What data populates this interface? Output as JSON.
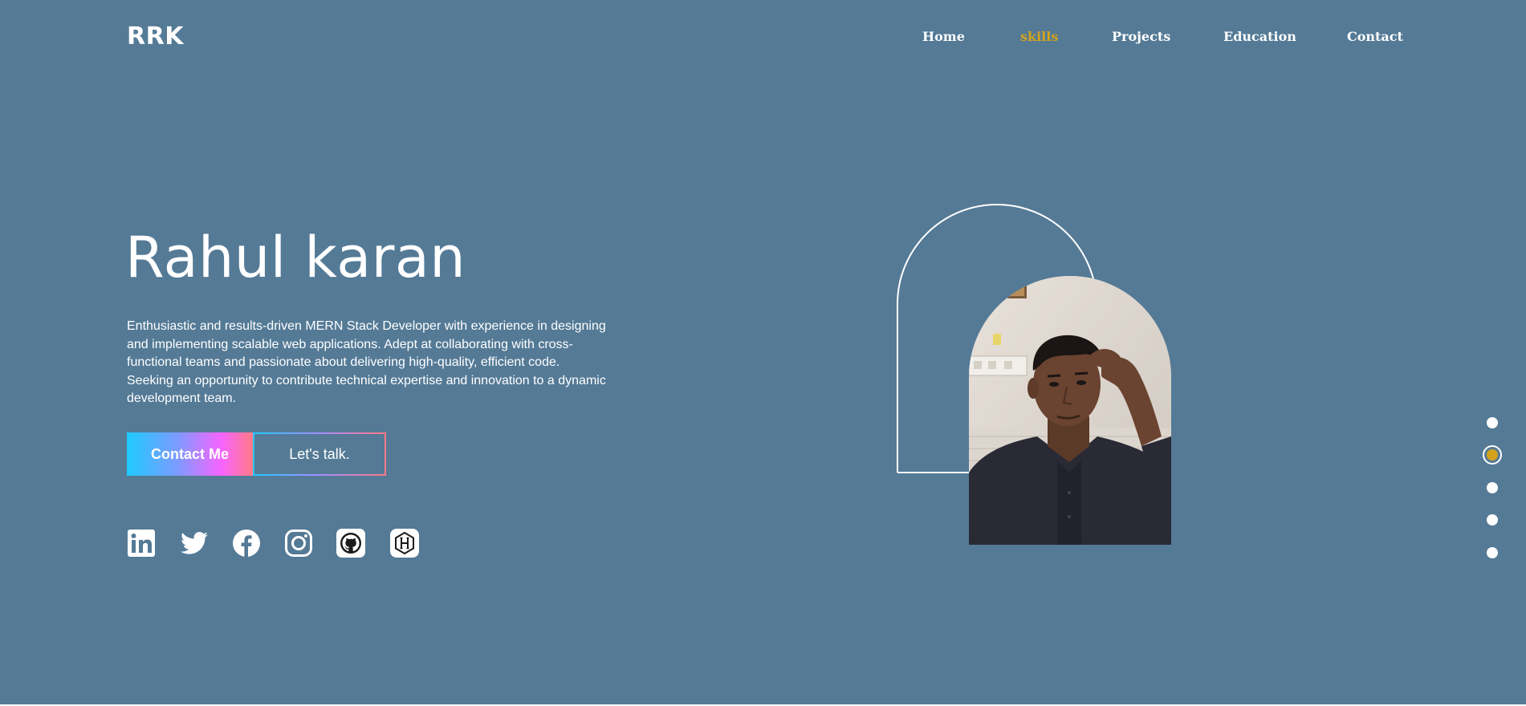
{
  "header": {
    "logo": "RRK",
    "nav": [
      {
        "label": "Home",
        "active": false
      },
      {
        "label": "skills",
        "active": true
      },
      {
        "label": "Projects",
        "active": false
      },
      {
        "label": "Education",
        "active": false
      },
      {
        "label": "Contact",
        "active": false
      }
    ]
  },
  "hero": {
    "name": "Rahul karan",
    "bio": "Enthusiastic and results-driven MERN Stack Developer with experience in designing and implementing scalable web applications. Adept at collaborating with cross-functional teams and passionate about delivering high-quality, efficient code. Seeking an opportunity to contribute technical expertise and innovation to a dynamic development team.",
    "contact_button": "Contact Me",
    "talk_button": "Let's talk."
  },
  "social": [
    "linkedin-icon",
    "twitter-icon",
    "facebook-icon",
    "instagram-icon",
    "github-icon",
    "hashnode-icon"
  ],
  "colors": {
    "background": "#547a96",
    "accent": "#d4a21c",
    "text": "#ffffff"
  },
  "section_dots": {
    "count": 5,
    "active_index": 1
  }
}
